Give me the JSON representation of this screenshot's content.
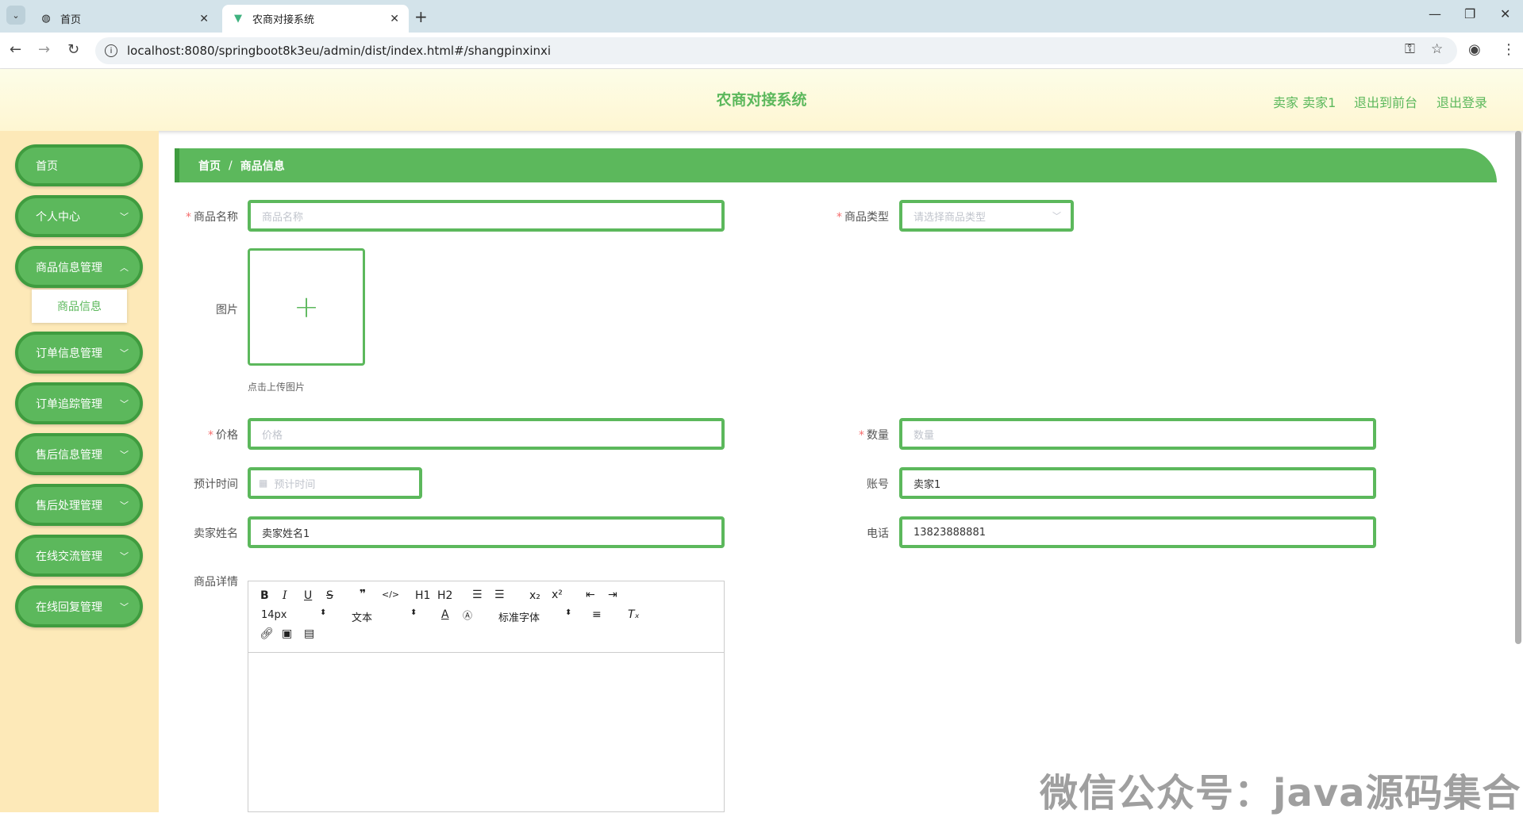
{
  "browser": {
    "tabs": [
      {
        "label": "首页"
      },
      {
        "label": "农商对接系统"
      }
    ],
    "url": "localhost:8080/springboot8k3eu/admin/dist/index.html#/shangpinxinxi"
  },
  "header": {
    "title": "农商对接系统",
    "user": "卖家 卖家1",
    "to_front": "退出到前台",
    "logout": "退出登录"
  },
  "sidebar": {
    "items": [
      {
        "label": "首页"
      },
      {
        "label": "个人中心"
      },
      {
        "label": "商品信息管理"
      },
      {
        "label": "订单信息管理"
      },
      {
        "label": "订单追踪管理"
      },
      {
        "label": "售后信息管理"
      },
      {
        "label": "售后处理管理"
      },
      {
        "label": "在线交流管理"
      },
      {
        "label": "在线回复管理"
      }
    ],
    "submenu": {
      "label": "商品信息"
    }
  },
  "breadcrumb": {
    "home": "首页",
    "separator": "/",
    "current": "商品信息"
  },
  "form": {
    "name": {
      "label": "商品名称",
      "placeholder": "商品名称"
    },
    "type": {
      "label": "商品类型",
      "placeholder": "请选择商品类型"
    },
    "image": {
      "label": "图片",
      "tip": "点击上传图片"
    },
    "price": {
      "label": "价格",
      "placeholder": "价格"
    },
    "quantity": {
      "label": "数量",
      "placeholder": "数量"
    },
    "eta": {
      "label": "预计时间",
      "placeholder": "预计时间"
    },
    "account": {
      "label": "账号",
      "value": "卖家1"
    },
    "seller_name": {
      "label": "卖家姓名",
      "value": "卖家姓名1"
    },
    "phone": {
      "label": "电话",
      "value": "13823888881"
    },
    "detail": {
      "label": "商品详情"
    }
  },
  "editor": {
    "font_size": "14px",
    "format": "文本",
    "font_family": "标准字体",
    "h1": "H1",
    "h2": "H2"
  },
  "watermark": "微信公众号：java源码集合",
  "colors": {
    "accent": "#5cb85c",
    "accent_dark": "#3f9c3f",
    "sidebar_bg": "#fde9b8",
    "required": "#f56c6c"
  }
}
